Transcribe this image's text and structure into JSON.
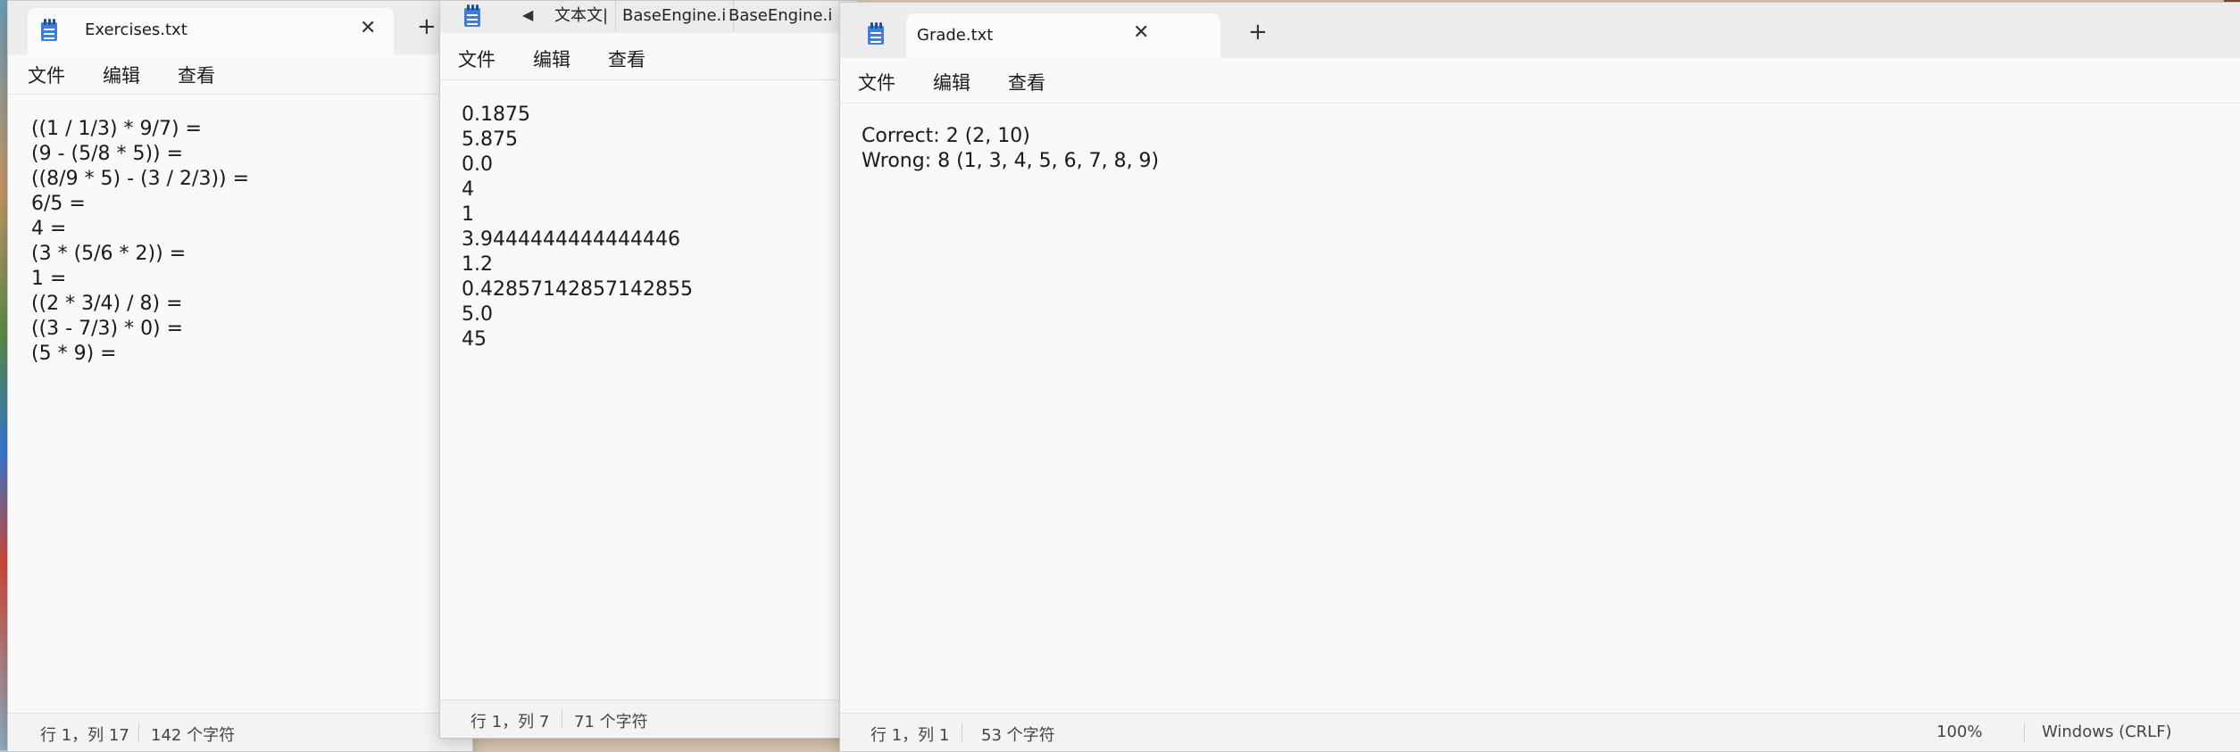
{
  "icons": {
    "app": "notepad-icon",
    "back": "caret-left-icon",
    "close": "close-icon",
    "new_tab": "plus-icon"
  },
  "menu": {
    "file": "文件",
    "edit": "编辑",
    "view": "查看"
  },
  "win1": {
    "tab_title": "Exercises.txt",
    "close": "✕",
    "plus": "+",
    "lines": [
      "((1 / 1/3) * 9/7) =",
      "(9 - (5/8 * 5)) =",
      "((8/9 * 5) - (3 / 2/3)) =",
      "6/5 =",
      "4 =",
      "(3 * (5/6 * 2)) =",
      "1 =",
      "((2 * 3/4) / 8) =",
      "((3 - 7/3) * 0) =",
      "(5 * 9) ="
    ],
    "status_pos": "行 1，列 17",
    "status_chars": "142 个字符"
  },
  "win2": {
    "back": "◀",
    "tabs": [
      "文本文|",
      "BaseEngine.i",
      "BaseEngine.i"
    ],
    "lines": [
      "0.1875",
      "5.875",
      "0.0",
      "4",
      "1",
      "3.9444444444444446",
      "1.2",
      "0.42857142857142855",
      "5.0",
      "45"
    ],
    "status_pos": "行 1，列 7",
    "status_chars": "71 个字符"
  },
  "win3": {
    "tab_title": "Grade.txt",
    "close": "✕",
    "plus": "+",
    "lines": [
      "Correct: 2 (2, 10)",
      "Wrong: 8 (1, 3, 4, 5, 6, 7, 8, 9)"
    ],
    "status_pos": "行 1，列 1",
    "status_chars": "53 个字符",
    "zoom": "100%",
    "encoding": "Windows (CRLF)"
  }
}
